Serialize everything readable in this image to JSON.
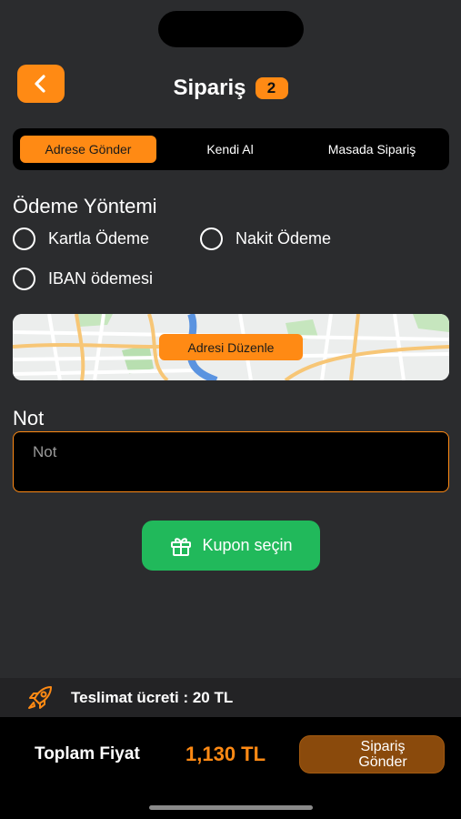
{
  "header": {
    "title": "Sipariş",
    "cart_count": "2"
  },
  "tabs": [
    {
      "label": "Adrese Gönder",
      "active": true
    },
    {
      "label": "Kendi Al",
      "active": false
    },
    {
      "label": "Masada Sipariş",
      "active": false
    }
  ],
  "payment": {
    "title": "Ödeme Yöntemi",
    "options": [
      "Kartla Ödeme",
      "Nakit Ödeme",
      "IBAN ödemesi"
    ]
  },
  "map": {
    "edit_label": "Adresi Düzenle"
  },
  "note": {
    "title": "Not",
    "placeholder": "Not"
  },
  "coupon": {
    "label": "Kupon seçin"
  },
  "delivery": {
    "text": "Teslimat ücreti : 20 TL"
  },
  "footer": {
    "total_label": "Toplam Fiyat",
    "total_value": "1,130 TL",
    "order_line1": "Sipariş",
    "order_line2": "Gönder"
  },
  "colors": {
    "accent": "#ff8a14",
    "coupon": "#21b95b",
    "background": "#2b2c2e"
  }
}
